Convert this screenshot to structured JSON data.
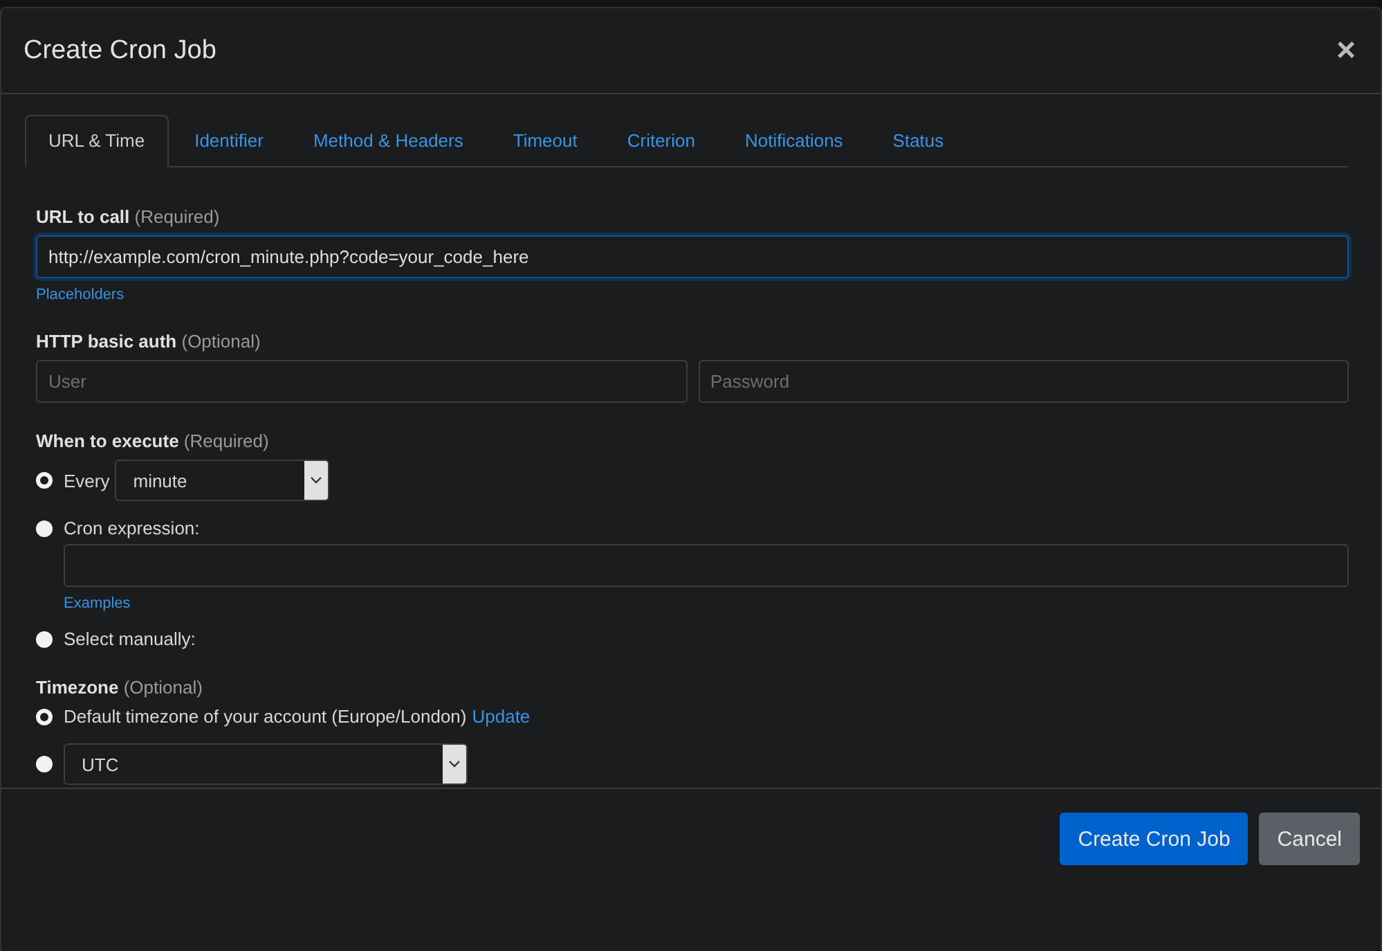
{
  "modal": {
    "title": "Create Cron Job",
    "close": "×"
  },
  "tabs": [
    {
      "label": "URL & Time",
      "selected": true
    },
    {
      "label": "Identifier",
      "selected": false
    },
    {
      "label": "Method & Headers",
      "selected": false
    },
    {
      "label": "Timeout",
      "selected": false
    },
    {
      "label": "Criterion",
      "selected": false
    },
    {
      "label": "Notifications",
      "selected": false
    },
    {
      "label": "Status",
      "selected": false
    }
  ],
  "url_field": {
    "label": "URL to call",
    "hint": "(Required)",
    "value": "http://example.com/cron_minute.php?code=your_code_here",
    "focused": true,
    "link": "Placeholders"
  },
  "auth": {
    "label": "HTTP basic auth",
    "hint": "(Optional)",
    "user_placeholder": "User",
    "password_placeholder": "Password"
  },
  "schedule": {
    "label": "When to execute",
    "hint": "(Required)",
    "options": [
      {
        "kind": "select",
        "label": "Every",
        "value": "minute",
        "selected": true
      },
      {
        "kind": "input",
        "label": "Cron expression:",
        "link": "Examples",
        "selected": false
      },
      {
        "kind": "plain",
        "label": "Select manually:",
        "selected": false
      }
    ]
  },
  "timezone": {
    "label": "Timezone",
    "hint": "(Optional)",
    "options": [
      {
        "kind": "text",
        "label": "Default timezone of your account (Europe/London)",
        "link": "Update",
        "selected": true
      },
      {
        "kind": "select",
        "value": "UTC",
        "selected": false
      }
    ]
  },
  "buttons": [
    {
      "label": "Create Cron Job",
      "kind": "primary"
    },
    {
      "label": "Cancel",
      "kind": "secondary"
    }
  ]
}
